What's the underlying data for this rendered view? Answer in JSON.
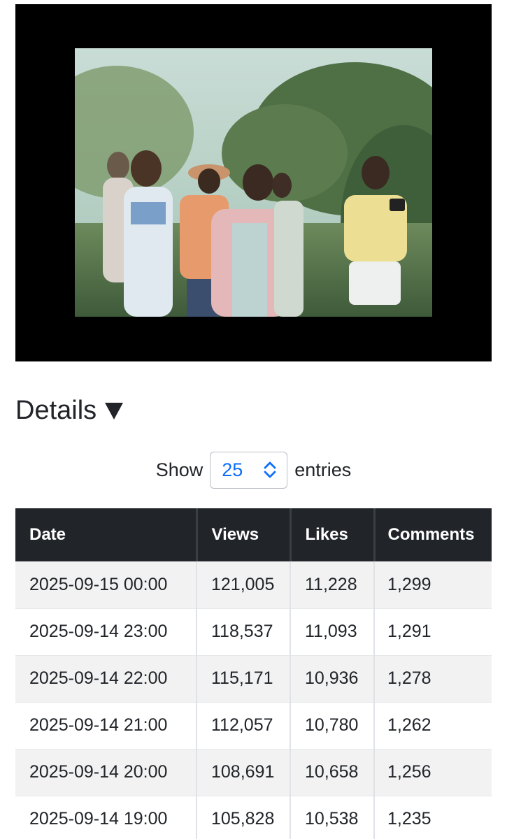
{
  "details": {
    "label": "Details"
  },
  "length_menu": {
    "show_label": "Show",
    "selected": "25",
    "entries_label": "entries"
  },
  "table": {
    "columns": [
      "Date",
      "Views",
      "Likes",
      "Comments"
    ],
    "rows": [
      [
        "2025-09-15 00:00",
        "121,005",
        "11,228",
        "1,299"
      ],
      [
        "2025-09-14 23:00",
        "118,537",
        "11,093",
        "1,291"
      ],
      [
        "2025-09-14 22:00",
        "115,171",
        "10,936",
        "1,278"
      ],
      [
        "2025-09-14 21:00",
        "112,057",
        "10,780",
        "1,262"
      ],
      [
        "2025-09-14 20:00",
        "108,691",
        "10,658",
        "1,256"
      ],
      [
        "2025-09-14 19:00",
        "105,828",
        "10,538",
        "1,235"
      ]
    ]
  },
  "colors": {
    "header_bg": "#212529",
    "select_text": "#0d6efd",
    "stripe": "#f2f2f2"
  }
}
